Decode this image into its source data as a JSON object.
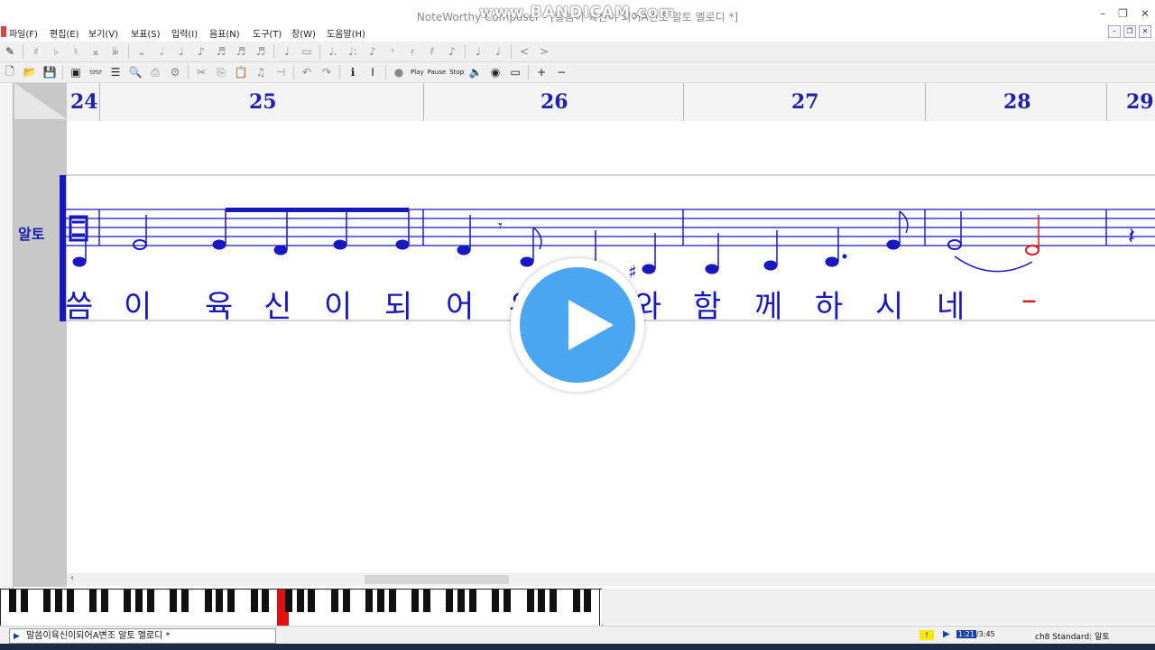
{
  "window": {
    "title": "NoteWorthy Composer - [말씀이 육신이 되어A변조 알토 멜로디 *]",
    "watermark": "www.BANDICAM.com",
    "controls": [
      "–",
      "❐",
      "✕"
    ]
  },
  "menu": [
    {
      "label": "파일(F)"
    },
    {
      "label": "편집(E)"
    },
    {
      "label": "보기(V)"
    },
    {
      "label": "보표(S)"
    },
    {
      "label": "입력(I)"
    },
    {
      "label": "음표(N)"
    },
    {
      "label": "도구(T)"
    },
    {
      "label": "창(W)"
    },
    {
      "label": "도움말(H)"
    }
  ],
  "toolbar": {
    "row1_icons": [
      "note-entry-icon",
      "sharp-icon",
      "flat-icon",
      "natural-icon",
      "double-sharp-icon",
      "double-flat-icon",
      "whole-note-icon",
      "half-note-icon",
      "quarter-note-icon",
      "eighth-note-icon",
      "sixteenth-note-icon",
      "thirtysecond-note-icon",
      "sixtyfourth-note-icon",
      "rest-icon",
      "dot-icon",
      "double-dot-icon",
      "triplet-icon",
      "slur-icon",
      "tie-icon",
      "beam-icon",
      "grace-icon",
      "stem-up-icon",
      "stem-down-icon",
      "crescendo-icon",
      "decrescendo-icon"
    ],
    "play_label": "Play",
    "pause_label": "Pause",
    "stop_label": "Stop"
  },
  "score": {
    "staff_name": "알토",
    "measures": [
      "24",
      "25",
      "26",
      "27",
      "28",
      "29"
    ],
    "lyrics": [
      "씀",
      "이",
      "육",
      "신",
      "이",
      "되",
      "어",
      "우",
      "와",
      "함",
      "께",
      "하",
      "시",
      "네",
      "–"
    ]
  },
  "statusbar": {
    "file_label": "말씀이육신이되어A변조 알토 멜로디 *",
    "warning": "!",
    "time_current": "1:21",
    "time_total": "3:45",
    "staff_info": "ch8 Standard: 알토"
  }
}
